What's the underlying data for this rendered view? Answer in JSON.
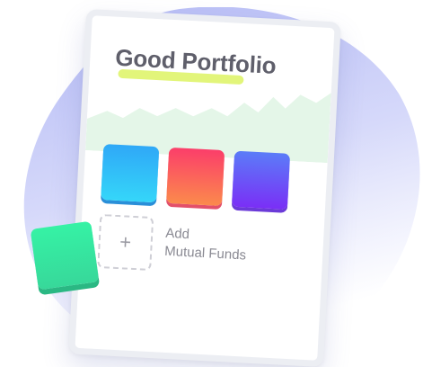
{
  "card": {
    "title": "Good Portfolio"
  },
  "add_fund": {
    "line1": "Add",
    "line2": "Mutual Funds",
    "icon": "plus-icon"
  },
  "tiles": {
    "blue": "#2fa8f7",
    "red": "#fb3e6a",
    "purple": "#6a4ff7",
    "green": "#36e6a0"
  },
  "colors": {
    "title_text": "#5f5f6b",
    "highlight": "#e2f57a",
    "background_blob": "#c9cdf7",
    "chart_fill": "#e6f7ea"
  }
}
